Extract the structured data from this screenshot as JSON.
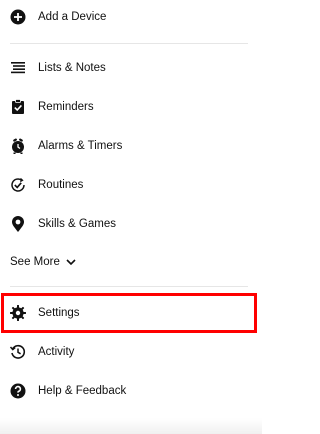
{
  "menu": {
    "add_device": {
      "label": "Add a Device",
      "icon": "plus-circle-icon"
    },
    "items": [
      {
        "label": "Lists & Notes",
        "icon": "list-icon"
      },
      {
        "label": "Reminders",
        "icon": "clipboard-check-icon"
      },
      {
        "label": "Alarms & Timers",
        "icon": "alarm-clock-icon"
      },
      {
        "label": "Routines",
        "icon": "routines-check-icon"
      },
      {
        "label": "Skills & Games",
        "icon": "map-pin-icon"
      }
    ],
    "see_more": {
      "label": "See More",
      "icon": "chevron-down-icon"
    },
    "bottom_items": [
      {
        "label": "Settings",
        "icon": "gear-icon",
        "highlighted": true
      },
      {
        "label": "Activity",
        "icon": "history-icon"
      },
      {
        "label": "Help & Feedback",
        "icon": "help-circle-icon"
      }
    ]
  },
  "colors": {
    "text": "#111111",
    "background": "#ffffff",
    "highlight_border": "#ff0000",
    "divider": "#e6e6e6"
  }
}
